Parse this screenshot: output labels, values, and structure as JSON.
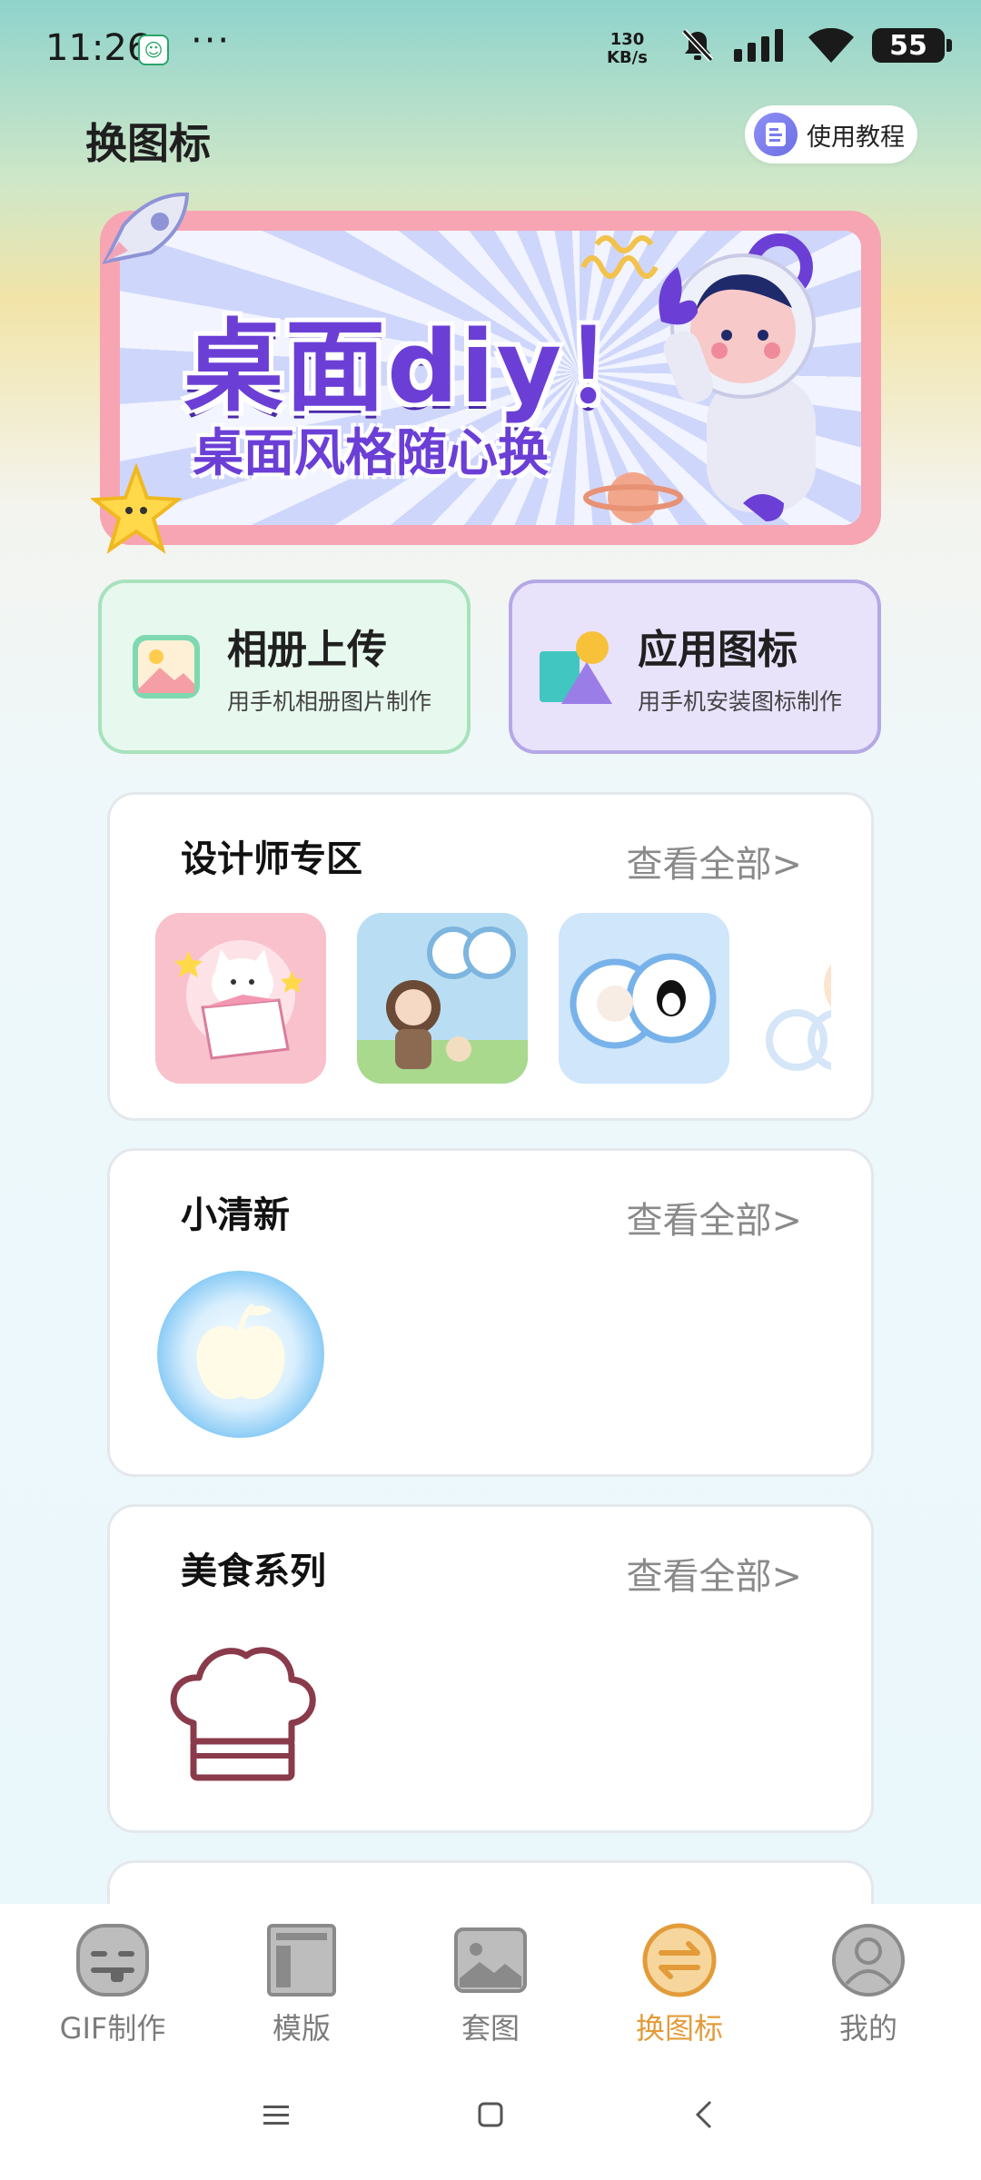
{
  "status_bar": {
    "time": "11:26",
    "more": "···",
    "speed_value": "130",
    "speed_unit": "KB/s",
    "battery": "55"
  },
  "header": {
    "title": "换图标",
    "tutorial_label": "使用教程"
  },
  "banner": {
    "title": "桌面diy！",
    "subtitle": "桌面风格随心换"
  },
  "features": [
    {
      "title": "相册上传",
      "subtitle": "用手机相册图片制作"
    },
    {
      "title": "应用图标",
      "subtitle": "用手机安装图标制作"
    }
  ],
  "sections": [
    {
      "title": "设计师专区",
      "more": "查看全部>"
    },
    {
      "title": "小清新",
      "more": "查看全部>"
    },
    {
      "title": "美食系列",
      "more": "查看全部>"
    }
  ],
  "bottom_nav": [
    {
      "label": "GIF制作",
      "icon": "gif-face-icon",
      "active": false
    },
    {
      "label": "模版",
      "icon": "template-icon",
      "active": false
    },
    {
      "label": "套图",
      "icon": "image-set-icon",
      "active": false
    },
    {
      "label": "换图标",
      "icon": "swap-icon",
      "active": true
    },
    {
      "label": "我的",
      "icon": "profile-icon",
      "active": false
    }
  ],
  "colors": {
    "accent": "#e39b39",
    "banner_border": "#f7a5b3",
    "banner_text": "#6b3fd6"
  }
}
